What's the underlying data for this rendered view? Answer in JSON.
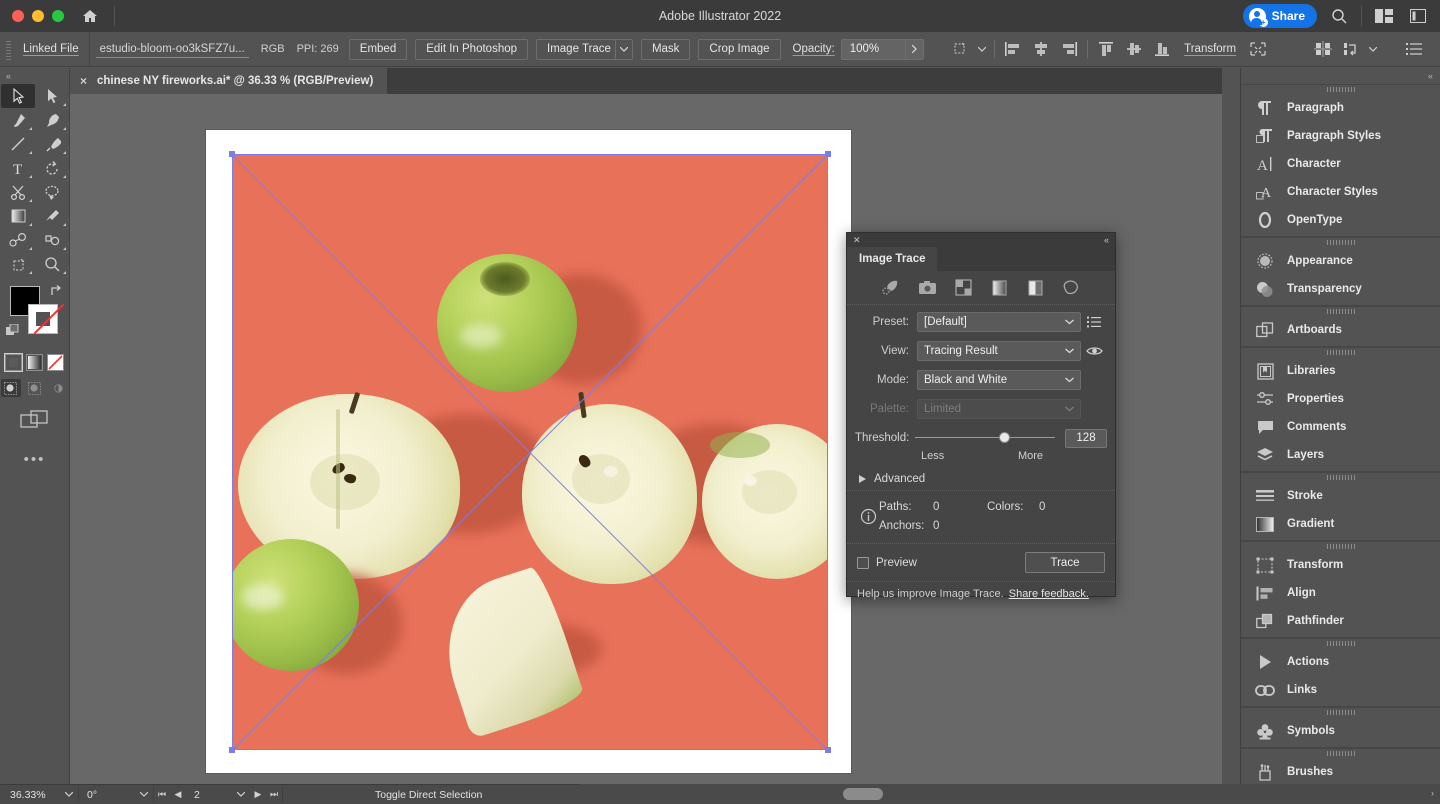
{
  "titlebar": {
    "app_title": "Adobe Illustrator 2022",
    "share_label": "Share",
    "icons": [
      "home-icon",
      "search-icon",
      "workspace-icon",
      "panel-icon"
    ]
  },
  "controlbar": {
    "link_label": "Linked File",
    "file_name": "estudio-bloom-oo3kSFZ7u...",
    "color_mode": "RGB",
    "ppi": "PPI: 269",
    "embed_label": "Embed",
    "edit_photoshop_label": "Edit In Photoshop",
    "image_trace_label": "Image Trace",
    "mask_label": "Mask",
    "crop_image_label": "Crop Image",
    "opacity_label": "Opacity:",
    "opacity_value": "100%",
    "transform_label": "Transform"
  },
  "tab": {
    "title": "chinese NY fireworks.ai* @ 36.33 % (RGB/Preview)",
    "close": "×"
  },
  "image_trace_panel": {
    "tab_label": "Image Trace",
    "preset_label": "Preset:",
    "preset_value": "[Default]",
    "view_label": "View:",
    "view_value": "Tracing Result",
    "mode_label": "Mode:",
    "mode_value": "Black and White",
    "palette_label": "Palette:",
    "palette_value": "Limited",
    "threshold_label": "Threshold:",
    "threshold_value": "128",
    "threshold_min_label": "Less",
    "threshold_max_label": "More",
    "advanced_label": "Advanced",
    "paths_label": "Paths:",
    "paths_value": "0",
    "anchors_label": "Anchors:",
    "anchors_value": "0",
    "colors_label": "Colors:",
    "colors_value": "0",
    "preview_label": "Preview",
    "trace_label": "Trace",
    "help_text": "Help us improve Image Trace.",
    "feedback_link": "Share feedback.",
    "preset_icons": [
      "auto-color-icon",
      "high-color-icon",
      "low-color-icon",
      "grayscale-icon",
      "black-white-icon",
      "outline-icon"
    ]
  },
  "dock": {
    "groups": [
      {
        "items": [
          {
            "label": "Paragraph",
            "icon": "paragraph-icon"
          },
          {
            "label": "Paragraph Styles",
            "icon": "paragraph-styles-icon"
          },
          {
            "label": "Character",
            "icon": "character-icon"
          },
          {
            "label": "Character Styles",
            "icon": "character-styles-icon"
          },
          {
            "label": "OpenType",
            "icon": "opentype-icon"
          }
        ]
      },
      {
        "items": [
          {
            "label": "Appearance",
            "icon": "appearance-icon"
          },
          {
            "label": "Transparency",
            "icon": "transparency-icon"
          }
        ]
      },
      {
        "items": [
          {
            "label": "Artboards",
            "icon": "artboards-icon"
          }
        ]
      },
      {
        "items": [
          {
            "label": "Libraries",
            "icon": "libraries-icon"
          },
          {
            "label": "Properties",
            "icon": "properties-icon"
          },
          {
            "label": "Comments",
            "icon": "comments-icon"
          },
          {
            "label": "Layers",
            "icon": "layers-icon"
          }
        ]
      },
      {
        "items": [
          {
            "label": "Stroke",
            "icon": "stroke-icon"
          },
          {
            "label": "Gradient",
            "icon": "gradient-icon"
          }
        ]
      },
      {
        "items": [
          {
            "label": "Transform",
            "icon": "transform-icon"
          },
          {
            "label": "Align",
            "icon": "align-icon"
          },
          {
            "label": "Pathfinder",
            "icon": "pathfinder-icon"
          }
        ]
      },
      {
        "items": [
          {
            "label": "Actions",
            "icon": "actions-icon"
          },
          {
            "label": "Links",
            "icon": "links-icon"
          }
        ]
      },
      {
        "items": [
          {
            "label": "Symbols",
            "icon": "symbols-icon"
          }
        ]
      },
      {
        "items": [
          {
            "label": "Brushes",
            "icon": "brushes-icon"
          }
        ]
      }
    ]
  },
  "statusbar": {
    "zoom": "36.33%",
    "rotation": "0°",
    "page": "2",
    "tool_status": "Toggle Direct Selection"
  },
  "toolbar": {
    "tools": [
      "selection-tool",
      "direct-selection-tool",
      "pen-tool",
      "curvature-tool",
      "line-tool",
      "paintbrush-tool",
      "type-tool",
      "rotate-tool",
      "scissors-tool",
      "lasso-tool",
      "gradient-tool",
      "eyedropper-tool",
      "blend-tool",
      "shape-builder-tool",
      "artboard-tool",
      "zoom-tool"
    ],
    "fill_color": "#000000",
    "stroke_color": "#ffffff",
    "mode_swatches": [
      "color-swatch",
      "gradient-swatch",
      "none-swatch"
    ],
    "draw_modes": [
      "draw-normal",
      "draw-behind",
      "draw-inside"
    ],
    "more_label": "•••"
  },
  "canvas": {
    "artboard_bg": "#e8715a",
    "selection_color": "#7b7ee8",
    "subject": "green apples, whole and sliced, on coral background"
  }
}
